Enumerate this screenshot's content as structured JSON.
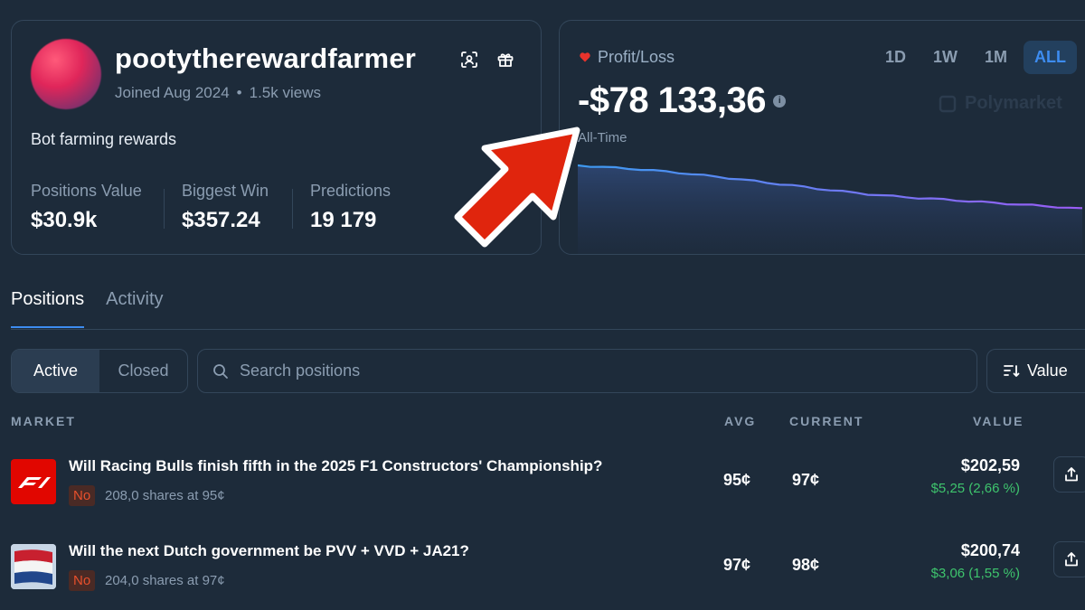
{
  "profile": {
    "username": "pootytherewardfarmer",
    "joined": "Joined Aug 2024",
    "views": "1.5k views",
    "bio": "Bot farming rewards",
    "stats": [
      {
        "label": "Positions Value",
        "value": "$30.9k"
      },
      {
        "label": "Biggest Win",
        "value": "$357.24"
      },
      {
        "label": "Predictions",
        "value": "19 179"
      }
    ],
    "icons": [
      "scan-icon",
      "gift-icon"
    ]
  },
  "pnl": {
    "label": "Profit/Loss",
    "value": "-$78 133,36",
    "period_label": "All-Time",
    "ranges": [
      "1D",
      "1W",
      "1M",
      "ALL"
    ],
    "active_range": "ALL",
    "watermark": "Polymarket",
    "trend": [
      1.0,
      0.985,
      0.97,
      0.955,
      0.94,
      0.925,
      0.905,
      0.885,
      0.865,
      0.84,
      0.815,
      0.79,
      0.765,
      0.74,
      0.71,
      0.68,
      0.655,
      0.63,
      0.6,
      0.57,
      0.545,
      0.52,
      0.495,
      0.47,
      0.45,
      0.43,
      0.415,
      0.4,
      0.385,
      0.37,
      0.355,
      0.34,
      0.325,
      0.31,
      0.295,
      0.28,
      0.265,
      0.25,
      0.235,
      0.215,
      0.2
    ]
  },
  "tabs": [
    "Positions",
    "Activity"
  ],
  "filter": {
    "active": "Active",
    "closed": "Closed"
  },
  "search": {
    "placeholder": "Search positions"
  },
  "sort": {
    "label": "Value"
  },
  "columns": {
    "market": "MARKET",
    "avg": "AVG",
    "current": "CURRENT",
    "value": "VALUE"
  },
  "positions": [
    {
      "title": "Will Racing Bulls finish fifth in the 2025 F1 Constructors' Championship?",
      "outcome": "No",
      "shares": "208,0 shares at 95¢",
      "avg": "95¢",
      "current": "97¢",
      "value": "$202,59",
      "change": "$5,25 (2,66 %)",
      "logo": "f1-logo"
    },
    {
      "title": "Will the next Dutch government be PVV + VVD + JA21?",
      "outcome": "No",
      "shares": "204,0 shares at 97¢",
      "avg": "97¢",
      "current": "98¢",
      "value": "$200,74",
      "change": "$3,06 (1,55 %)",
      "logo": "dutch-flag"
    }
  ],
  "colors": {
    "background": "#1d2b3a",
    "accent": "#3d8cf0",
    "positive": "#3ec46d",
    "negative": "#e8502c",
    "arrow": "#e0250d"
  }
}
